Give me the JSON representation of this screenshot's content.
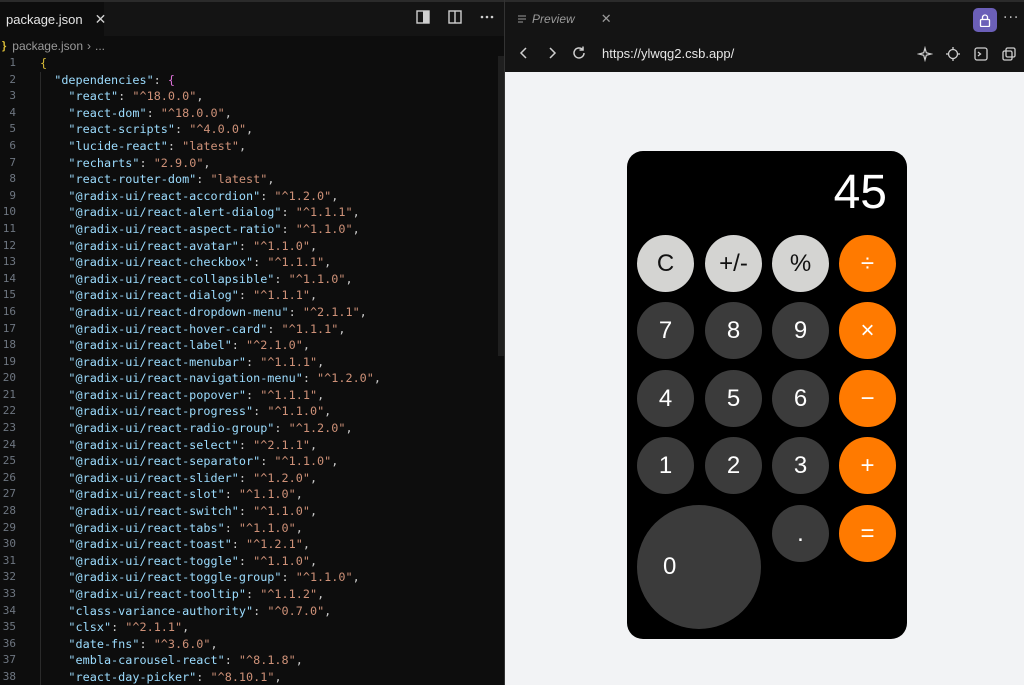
{
  "editor": {
    "tab_label": "package.json",
    "tab_close": "✕",
    "breadcrumb": {
      "file": "package.json",
      "rest": "..."
    },
    "lines": [
      {
        "n": "1",
        "indent": "",
        "key": "",
        "open": "{"
      },
      {
        "n": "2",
        "indent": "  ",
        "key": "dependencies",
        "open": "{"
      },
      {
        "n": "3",
        "indent": "    ",
        "key": "react",
        "value": "^18.0.0"
      },
      {
        "n": "4",
        "indent": "    ",
        "key": "react-dom",
        "value": "^18.0.0"
      },
      {
        "n": "5",
        "indent": "    ",
        "key": "react-scripts",
        "value": "^4.0.0"
      },
      {
        "n": "6",
        "indent": "    ",
        "key": "lucide-react",
        "value": "latest"
      },
      {
        "n": "7",
        "indent": "    ",
        "key": "recharts",
        "value": "2.9.0"
      },
      {
        "n": "8",
        "indent": "    ",
        "key": "react-router-dom",
        "value": "latest"
      },
      {
        "n": "9",
        "indent": "    ",
        "key": "@radix-ui/react-accordion",
        "value": "^1.2.0"
      },
      {
        "n": "10",
        "indent": "    ",
        "key": "@radix-ui/react-alert-dialog",
        "value": "^1.1.1"
      },
      {
        "n": "11",
        "indent": "    ",
        "key": "@radix-ui/react-aspect-ratio",
        "value": "^1.1.0"
      },
      {
        "n": "12",
        "indent": "    ",
        "key": "@radix-ui/react-avatar",
        "value": "^1.1.0"
      },
      {
        "n": "13",
        "indent": "    ",
        "key": "@radix-ui/react-checkbox",
        "value": "^1.1.1"
      },
      {
        "n": "14",
        "indent": "    ",
        "key": "@radix-ui/react-collapsible",
        "value": "^1.1.0"
      },
      {
        "n": "15",
        "indent": "    ",
        "key": "@radix-ui/react-dialog",
        "value": "^1.1.1"
      },
      {
        "n": "16",
        "indent": "    ",
        "key": "@radix-ui/react-dropdown-menu",
        "value": "^2.1.1"
      },
      {
        "n": "17",
        "indent": "    ",
        "key": "@radix-ui/react-hover-card",
        "value": "^1.1.1"
      },
      {
        "n": "18",
        "indent": "    ",
        "key": "@radix-ui/react-label",
        "value": "^2.1.0"
      },
      {
        "n": "19",
        "indent": "    ",
        "key": "@radix-ui/react-menubar",
        "value": "^1.1.1"
      },
      {
        "n": "20",
        "indent": "    ",
        "key": "@radix-ui/react-navigation-menu",
        "value": "^1.2.0"
      },
      {
        "n": "21",
        "indent": "    ",
        "key": "@radix-ui/react-popover",
        "value": "^1.1.1"
      },
      {
        "n": "22",
        "indent": "    ",
        "key": "@radix-ui/react-progress",
        "value": "^1.1.0"
      },
      {
        "n": "23",
        "indent": "    ",
        "key": "@radix-ui/react-radio-group",
        "value": "^1.2.0"
      },
      {
        "n": "24",
        "indent": "    ",
        "key": "@radix-ui/react-select",
        "value": "^2.1.1"
      },
      {
        "n": "25",
        "indent": "    ",
        "key": "@radix-ui/react-separator",
        "value": "^1.1.0"
      },
      {
        "n": "26",
        "indent": "    ",
        "key": "@radix-ui/react-slider",
        "value": "^1.2.0"
      },
      {
        "n": "27",
        "indent": "    ",
        "key": "@radix-ui/react-slot",
        "value": "^1.1.0"
      },
      {
        "n": "28",
        "indent": "    ",
        "key": "@radix-ui/react-switch",
        "value": "^1.1.0"
      },
      {
        "n": "29",
        "indent": "    ",
        "key": "@radix-ui/react-tabs",
        "value": "^1.1.0"
      },
      {
        "n": "30",
        "indent": "    ",
        "key": "@radix-ui/react-toast",
        "value": "^1.2.1"
      },
      {
        "n": "31",
        "indent": "    ",
        "key": "@radix-ui/react-toggle",
        "value": "^1.1.0"
      },
      {
        "n": "32",
        "indent": "    ",
        "key": "@radix-ui/react-toggle-group",
        "value": "^1.1.0"
      },
      {
        "n": "33",
        "indent": "    ",
        "key": "@radix-ui/react-tooltip",
        "value": "^1.1.2"
      },
      {
        "n": "34",
        "indent": "    ",
        "key": "class-variance-authority",
        "value": "^0.7.0"
      },
      {
        "n": "35",
        "indent": "    ",
        "key": "clsx",
        "value": "^2.1.1"
      },
      {
        "n": "36",
        "indent": "    ",
        "key": "date-fns",
        "value": "^3.6.0"
      },
      {
        "n": "37",
        "indent": "    ",
        "key": "embla-carousel-react",
        "value": "^8.1.8"
      },
      {
        "n": "38",
        "indent": "    ",
        "key": "react-day-picker",
        "value": "^8.10.1"
      }
    ]
  },
  "preview": {
    "tab_label": "Preview",
    "tab_close": "✕",
    "more": "···",
    "url": "https://ylwqg2.csb.app/"
  },
  "calculator": {
    "display": "45",
    "keys": [
      {
        "label": "C",
        "kind": "light",
        "name": "clear-button"
      },
      {
        "label": "+/-",
        "kind": "light",
        "name": "sign-toggle-button"
      },
      {
        "label": "%",
        "kind": "light",
        "name": "percent-button"
      },
      {
        "label": "÷",
        "kind": "op",
        "name": "divide-button"
      },
      {
        "label": "7",
        "kind": "dark",
        "name": "digit-7-button"
      },
      {
        "label": "8",
        "kind": "dark",
        "name": "digit-8-button"
      },
      {
        "label": "9",
        "kind": "dark",
        "name": "digit-9-button"
      },
      {
        "label": "×",
        "kind": "op",
        "name": "multiply-button"
      },
      {
        "label": "4",
        "kind": "dark",
        "name": "digit-4-button"
      },
      {
        "label": "5",
        "kind": "dark",
        "name": "digit-5-button"
      },
      {
        "label": "6",
        "kind": "dark",
        "name": "digit-6-button"
      },
      {
        "label": "−",
        "kind": "op",
        "name": "subtract-button"
      },
      {
        "label": "1",
        "kind": "dark",
        "name": "digit-1-button"
      },
      {
        "label": "2",
        "kind": "dark",
        "name": "digit-2-button"
      },
      {
        "label": "3",
        "kind": "dark",
        "name": "digit-3-button"
      },
      {
        "label": "+",
        "kind": "op",
        "name": "add-button"
      },
      {
        "label": "0",
        "kind": "dark",
        "name": "digit-0-button"
      },
      {
        "label": ".",
        "kind": "dark",
        "name": "decimal-button"
      },
      {
        "label": "=",
        "kind": "op",
        "name": "equals-button"
      }
    ]
  },
  "colors": {
    "operator": "#ff7a00",
    "function_key": "#d4d4d2",
    "digit_key": "#3b3b3b",
    "lock_button": "#6b5fb8"
  },
  "icons": [
    "close-icon",
    "toggle-panel-icon",
    "split-editor-icon",
    "more-icon",
    "preview-file-icon",
    "lock-icon",
    "back-icon",
    "forward-icon",
    "reload-icon",
    "sparkle-icon",
    "crosshair-icon",
    "terminal-icon",
    "open-external-icon"
  ]
}
